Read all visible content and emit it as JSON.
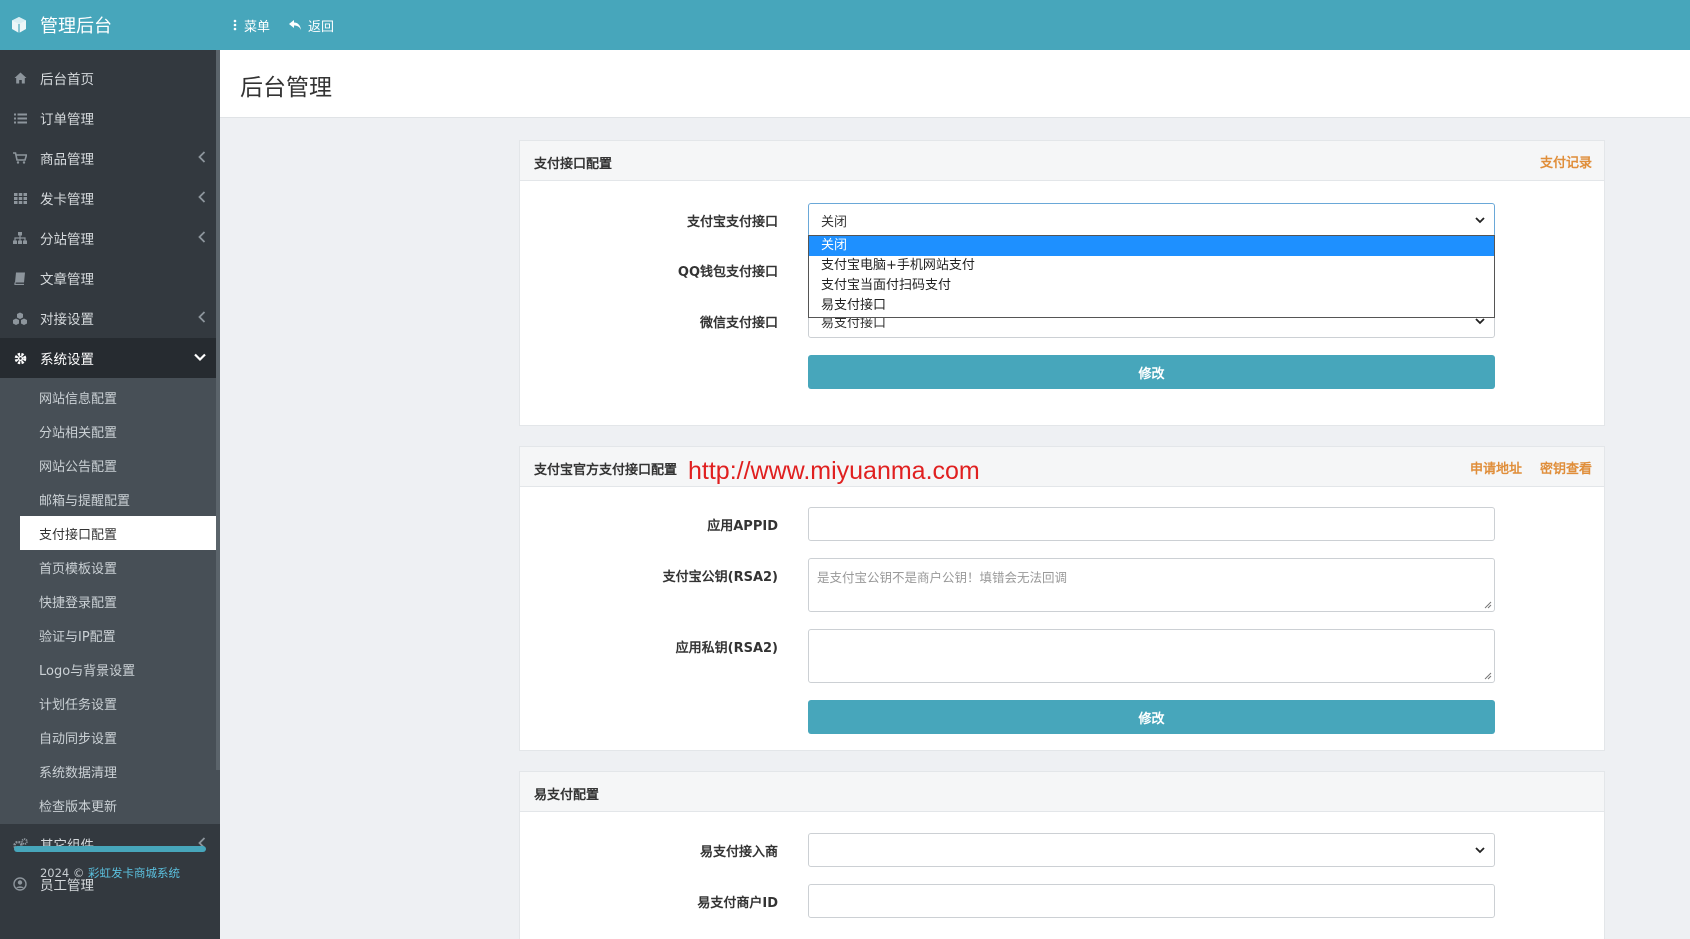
{
  "topbar": {
    "brand": "管理后台",
    "menu_label": "菜单",
    "back_label": "返回",
    "bg_color": "#47a6bb"
  },
  "sidebar": {
    "items": [
      {
        "label": "后台首页",
        "icon": "home-icon"
      },
      {
        "label": "订单管理",
        "icon": "list-icon"
      },
      {
        "label": "商品管理",
        "icon": "cart-icon",
        "expandable": true
      },
      {
        "label": "发卡管理",
        "icon": "grid-icon",
        "expandable": true
      },
      {
        "label": "分站管理",
        "icon": "sitemap-icon",
        "expandable": true
      },
      {
        "label": "文章管理",
        "icon": "book-icon"
      },
      {
        "label": "对接设置",
        "icon": "cubes-icon",
        "expandable": true
      },
      {
        "label": "系统设置",
        "icon": "gear-icon",
        "open": true
      }
    ],
    "submenu": [
      "网站信息配置",
      "分站相关配置",
      "网站公告配置",
      "邮箱与提醒配置",
      "支付接口配置",
      "首页模板设置",
      "快捷登录配置",
      "验证与IP配置",
      "Logo与背景设置",
      "计划任务设置",
      "自动同步设置",
      "系统数据清理",
      "检查版本更新"
    ],
    "active_submenu": "支付接口配置",
    "items_after": [
      {
        "label": "其它组件",
        "icon": "cogs-icon",
        "expandable": true
      },
      {
        "label": "员工管理",
        "icon": "user-circle-icon"
      }
    ],
    "footer_prefix": "2024 ©",
    "footer_link": "彩虹发卡商城系统"
  },
  "page": {
    "title": "后台管理"
  },
  "panel1": {
    "title": "支付接口配置",
    "link": "支付记录",
    "fields": [
      {
        "label": "支付宝支付接口",
        "value": "关闭"
      },
      {
        "label": "QQ钱包支付接口",
        "value": ""
      },
      {
        "label": "微信支付接口",
        "value": "易支付接口"
      }
    ],
    "submit": "修改",
    "dropdown_options": [
      "关闭",
      "支付宝电脑+手机网站支付",
      "支付宝当面付扫码支付",
      "易支付接口"
    ],
    "dropdown_selected": "关闭"
  },
  "panel2": {
    "title": "支付宝官方支付接口配置",
    "links": [
      "申请地址",
      "密钥查看"
    ],
    "fields": [
      {
        "label": "应用APPID",
        "value": ""
      },
      {
        "label": "支付宝公钥(RSA2)",
        "placeholder": "是支付宝公钥不是商户公钥！填错会无法回调"
      },
      {
        "label": "应用私钥(RSA2)",
        "value": ""
      }
    ],
    "submit": "修改"
  },
  "panel3": {
    "title": "易支付配置",
    "fields": [
      {
        "label": "易支付接入商",
        "value": ""
      },
      {
        "label": "易支付商户ID",
        "value": ""
      }
    ]
  },
  "watermark": "http://www.miyuanma.com"
}
